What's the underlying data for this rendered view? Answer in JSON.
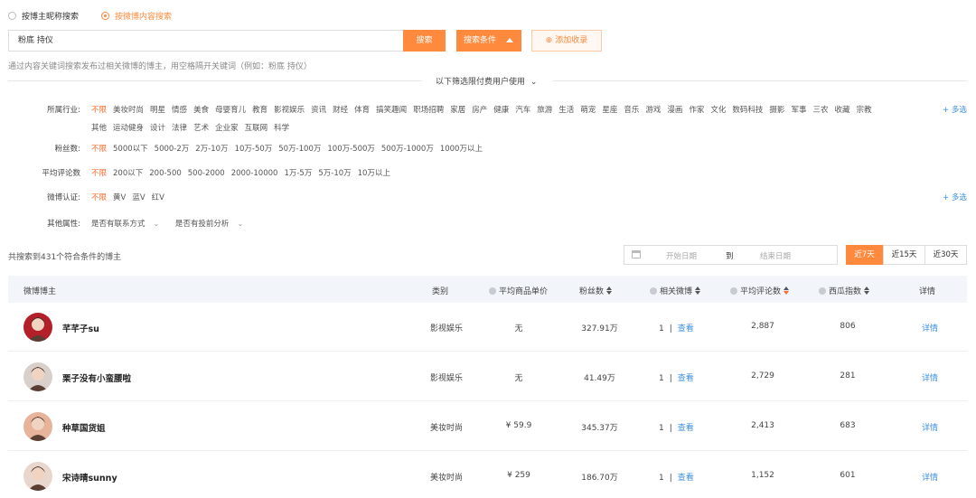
{
  "search_mode": {
    "by_nickname": "按博主昵称搜索",
    "by_content": "按微博内容搜索"
  },
  "search": {
    "value": "粉底 持仪",
    "button": "搜索",
    "conditions_button": "搜索条件",
    "add_collection": "添加收录",
    "hint": "通过内容关键词搜索发布过相关微博的博主，用空格隔开关键词（例如：粉底 持仪）"
  },
  "paid_note": "以下筛选限付费用户使用",
  "filters": {
    "industry": {
      "label": "所属行业:",
      "row1": [
        "不限",
        "美妆时尚",
        "明星",
        "情感",
        "美食",
        "母婴育儿",
        "教育",
        "影视娱乐",
        "资讯",
        "财经",
        "体育",
        "搞笑趣闻",
        "职场招聘",
        "家居",
        "房产",
        "健康",
        "汽车",
        "旅游",
        "生活",
        "萌宠",
        "星座",
        "音乐",
        "游戏",
        "漫画",
        "作家",
        "文化",
        "数码科技",
        "摄影",
        "军事",
        "三农",
        "收藏",
        "宗教"
      ],
      "row2": [
        "其他",
        "运动健身",
        "设计",
        "法律",
        "艺术",
        "企业家",
        "互联网",
        "科学"
      ],
      "more": "+ 多选"
    },
    "fans": {
      "label": "粉丝数:",
      "options": [
        "不限",
        "5000以下",
        "5000-2万",
        "2万-10万",
        "10万-50万",
        "50万-100万",
        "100万-500万",
        "500万-1000万",
        "1000万以上"
      ]
    },
    "comments": {
      "label": "平均评论数",
      "options": [
        "不限",
        "200以下",
        "200-500",
        "500-2000",
        "2000-10000",
        "1万-5万",
        "5万-10万",
        "10万以上"
      ]
    },
    "verify": {
      "label": "微博认证:",
      "options": [
        "不限",
        "黄V",
        "蓝V",
        "红V"
      ],
      "more": "+ 多选"
    },
    "other": {
      "label": "其他属性:",
      "options": [
        "是否有联系方式",
        "是否有投前分析"
      ]
    }
  },
  "results": {
    "count_text": "共搜索到431个符合条件的博主",
    "start_date": "开始日期",
    "to": "到",
    "end_date": "结束日期",
    "ranges": [
      "近7天",
      "近15天",
      "近30天"
    ]
  },
  "table": {
    "headers": {
      "blogger": "微博博主",
      "category": "类别",
      "avg_price": "平均商品单价",
      "fans": "粉丝数",
      "related": "相关微博",
      "avg_comments": "平均评论数",
      "xigua": "西瓜指数",
      "detail": "详情"
    },
    "rows": [
      {
        "name": "芊芊子su",
        "category": "影视娱乐",
        "price": "无",
        "fans": "327.91万",
        "related": "1",
        "view": "查看",
        "comments": "2,887",
        "xigua": "806",
        "detail": "详情",
        "avatar_color": "#b3202a"
      },
      {
        "name": "栗子没有小蛮腰啦",
        "category": "影视娱乐",
        "price": "无",
        "fans": "41.49万",
        "related": "1",
        "view": "查看",
        "comments": "2,729",
        "xigua": "281",
        "detail": "详情",
        "avatar_color": "#d9d0cc"
      },
      {
        "name": "种草国货姐",
        "category": "美妆时尚",
        "price": "¥ 59.9",
        "fans": "345.37万",
        "related": "1",
        "view": "查看",
        "comments": "2,413",
        "xigua": "683",
        "detail": "详情",
        "avatar_color": "#e7b49b"
      },
      {
        "name": "宋诗晴sunny",
        "category": "美妆时尚",
        "price": "¥ 259",
        "fans": "186.70万",
        "related": "1",
        "view": "查看",
        "comments": "1,152",
        "xigua": "601",
        "detail": "详情",
        "avatar_color": "#e9d6cc"
      }
    ]
  }
}
